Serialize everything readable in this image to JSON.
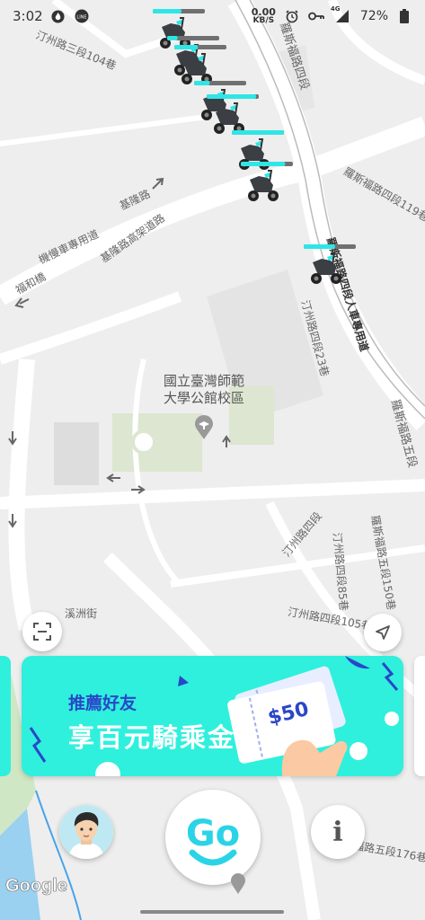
{
  "status_bar": {
    "time": "3:02",
    "net_speed_value": "0.00",
    "net_speed_unit": "KB/S",
    "signal_label": "4G",
    "battery": "72%"
  },
  "map": {
    "campus_name_line1": "國立臺灣師範",
    "campus_name_line2": "大學公館校區",
    "streets": {
      "s1": "汀州路三段104巷",
      "s2": "羅斯福路四段",
      "s3": "羅斯福路四段119巷",
      "s4": "基隆路",
      "s5": "機慢車專用道",
      "s6": "福和橋",
      "s7": "基隆路高架道路",
      "s8": "羅斯福路四段人車專用道",
      "s9": "汀州路四段23巷",
      "s10": "羅斯福路五段",
      "s11": "汀州路四段",
      "s12": "汀州路四段85巷",
      "s13": "羅斯福路五段150巷",
      "s14": "汀州路四段105巷",
      "s15": "溪洲街",
      "s16": "福路五段176巷"
    },
    "attribution": "Google"
  },
  "promo": {
    "line1": "推薦好友",
    "line2": "享百元騎乘金",
    "ticket_text": "$50"
  },
  "bottom": {
    "go_label": "Go",
    "info_label": "i"
  },
  "colors": {
    "brand_teal": "#2ff0dd",
    "brand_blue": "#2a47c8",
    "battery_teal": "#2ee6e6",
    "battery_empty": "#707070"
  },
  "scooters": [
    {
      "battery": 0.55
    },
    {
      "battery": 0.2
    },
    {
      "battery": 0.45
    },
    {
      "battery": 0.3
    },
    {
      "battery": 0.95
    },
    {
      "battery": 1.0
    },
    {
      "battery": 0.85
    },
    {
      "battery": 0.6
    }
  ]
}
